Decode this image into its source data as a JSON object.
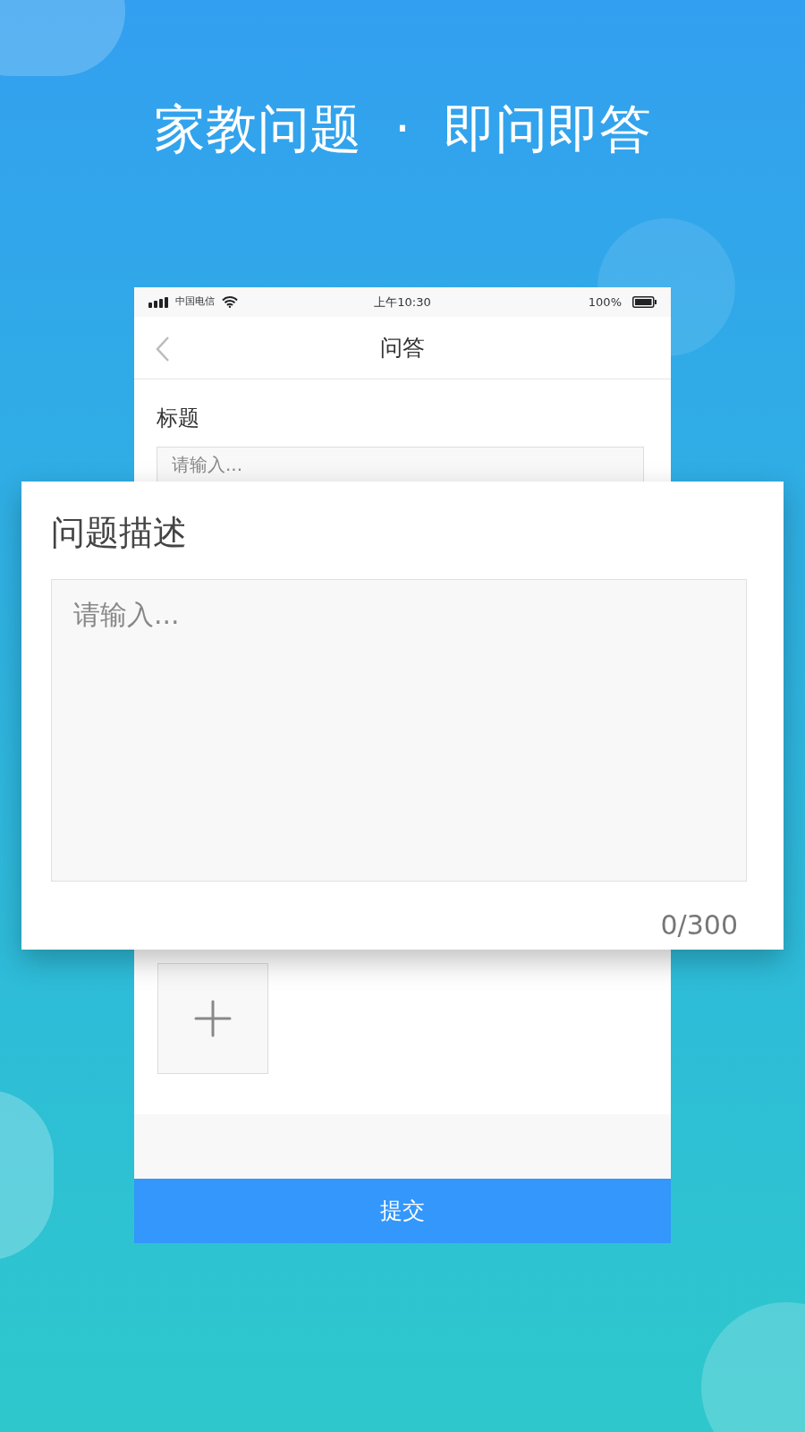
{
  "headline": "家教问题  ·  即问即答",
  "status_bar": {
    "carrier": "中国电信",
    "time": "上午10:30",
    "battery": "100%"
  },
  "nav": {
    "title": "问答"
  },
  "title_field": {
    "label": "标题",
    "placeholder": "请输入..."
  },
  "description_card": {
    "label": "问题描述",
    "placeholder": "请输入...",
    "counter": "0/300"
  },
  "submit": "提交"
}
